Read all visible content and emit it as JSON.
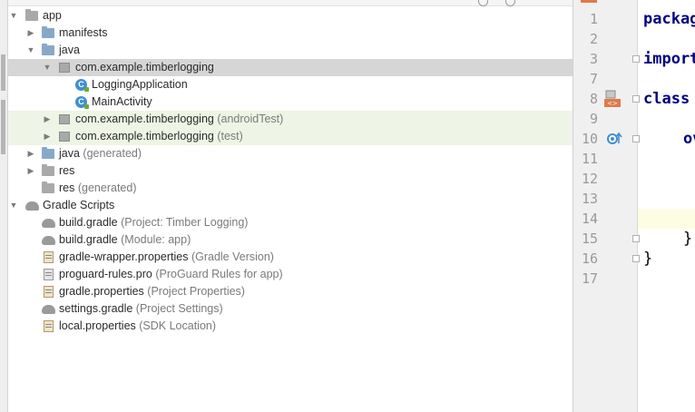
{
  "project_tree": {
    "items": [
      {
        "label": "app",
        "hint": ""
      },
      {
        "label": "manifests",
        "hint": ""
      },
      {
        "label": "java",
        "hint": ""
      },
      {
        "label": "com.example.timberlogging",
        "hint": ""
      },
      {
        "label": "LoggingApplication",
        "hint": ""
      },
      {
        "label": "MainActivity",
        "hint": ""
      },
      {
        "label": "com.example.timberlogging",
        "hint": "(androidTest)"
      },
      {
        "label": "com.example.timberlogging",
        "hint": "(test)"
      },
      {
        "label": "java",
        "hint": "(generated)"
      },
      {
        "label": "res",
        "hint": ""
      },
      {
        "label": "res",
        "hint": "(generated)"
      },
      {
        "label": "Gradle Scripts",
        "hint": ""
      },
      {
        "label": "build.gradle",
        "hint": "(Project: Timber Logging)"
      },
      {
        "label": "build.gradle",
        "hint": "(Module: app)"
      },
      {
        "label": "gradle-wrapper.properties",
        "hint": "(Gradle Version)"
      },
      {
        "label": "proguard-rules.pro",
        "hint": "(ProGuard Rules for app)"
      },
      {
        "label": "gradle.properties",
        "hint": "(Project Properties)"
      },
      {
        "label": "settings.gradle",
        "hint": "(Project Settings)"
      },
      {
        "label": "local.properties",
        "hint": "(SDK Location)"
      }
    ]
  },
  "editor": {
    "line_numbers": [
      "1",
      "2",
      "3",
      "7",
      "8",
      "9",
      "10",
      "11",
      "12",
      "13",
      "14",
      "15",
      "16",
      "17"
    ],
    "code": {
      "line1": "packag",
      "line3": "import",
      "line8": "class",
      "line10": "ov",
      "line15": "}",
      "line16": "}"
    }
  },
  "colors": {
    "selected_row": "#d6d6d6",
    "test_row": "#eef5e6",
    "keyword": "#000080",
    "caret_line": "#fdfde3"
  }
}
